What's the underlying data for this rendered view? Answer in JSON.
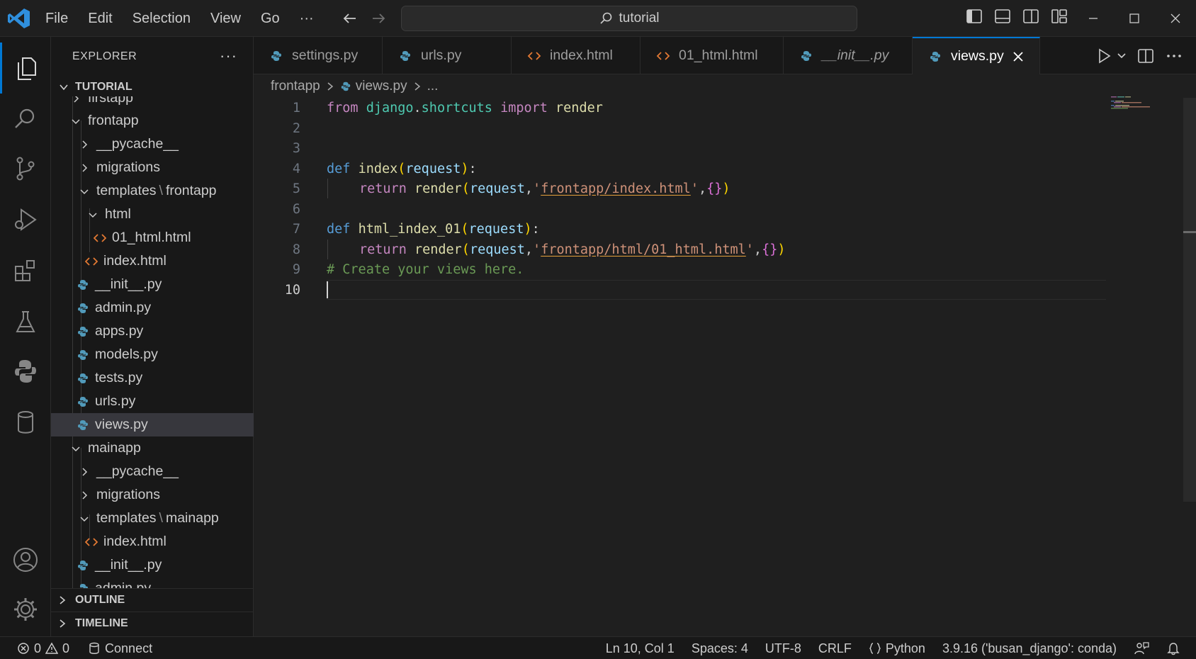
{
  "titlebar": {
    "menu": [
      "File",
      "Edit",
      "Selection",
      "View",
      "Go",
      "···"
    ],
    "search_text": "tutorial"
  },
  "sidebar": {
    "title": "EXPLORER",
    "more": "···",
    "root": "TUTORIAL",
    "partial_top": "firstapp",
    "items": [
      {
        "label": "frontapp",
        "kind": "folder-open"
      },
      {
        "label": "__pycache__",
        "kind": "folder"
      },
      {
        "label": "migrations",
        "kind": "folder"
      },
      {
        "label": "templates",
        "sep": "\\",
        "label2": "frontapp",
        "kind": "folder-open"
      },
      {
        "label": "html",
        "kind": "folder-open"
      },
      {
        "label": "01_html.html",
        "kind": "html"
      },
      {
        "label": "index.html",
        "kind": "html"
      },
      {
        "label": "__init__.py",
        "kind": "py"
      },
      {
        "label": "admin.py",
        "kind": "py"
      },
      {
        "label": "apps.py",
        "kind": "py"
      },
      {
        "label": "models.py",
        "kind": "py"
      },
      {
        "label": "tests.py",
        "kind": "py"
      },
      {
        "label": "urls.py",
        "kind": "py"
      },
      {
        "label": "views.py",
        "kind": "py"
      },
      {
        "label": "mainapp",
        "kind": "folder-open"
      },
      {
        "label": "__pycache__",
        "kind": "folder"
      },
      {
        "label": "migrations",
        "kind": "folder"
      },
      {
        "label": "templates",
        "sep": "\\",
        "label2": "mainapp",
        "kind": "folder-open"
      },
      {
        "label": "index.html",
        "kind": "html"
      },
      {
        "label": "__init__.py",
        "kind": "py"
      }
    ],
    "partial_bottom": "admin.py",
    "outline": "OUTLINE",
    "timeline": "TIMELINE"
  },
  "tabs": [
    {
      "label": "settings.py",
      "kind": "py"
    },
    {
      "label": "urls.py",
      "kind": "py"
    },
    {
      "label": "index.html",
      "kind": "html"
    },
    {
      "label": "01_html.html",
      "kind": "html"
    },
    {
      "label": "__init__.py",
      "kind": "py",
      "italic": true
    },
    {
      "label": "views.py",
      "kind": "py",
      "active": true
    }
  ],
  "breadcrumb": {
    "folder": "frontapp",
    "file": "views.py",
    "more": "..."
  },
  "editor": {
    "line_numbers": [
      "1",
      "2",
      "3",
      "4",
      "5",
      "6",
      "7",
      "8",
      "9",
      "10"
    ],
    "code": {
      "l1_from": "from",
      "l1_mod1": "django",
      "l1_dot": ".",
      "l1_mod2": "shortcuts",
      "l1_import": "import",
      "l1_render": "render",
      "l4_def": "def",
      "l4_name": "index",
      "l4_open": "(",
      "l4_param": "request",
      "l4_close": ")",
      "l4_colon": ":",
      "l5_return": "return",
      "l5_render": "render",
      "l5_open": "(",
      "l5_arg": "request",
      "l5_comma": ",",
      "l5_q1": "'",
      "l5_str": "frontapp/index.html",
      "l5_q2": "'",
      "l5_comma2": ",",
      "l5_dict": "{}",
      "l5_close": ")",
      "l7_def": "def",
      "l7_name": "html_index_01",
      "l7_open": "(",
      "l7_param": "request",
      "l7_close": ")",
      "l7_colon": ":",
      "l8_return": "return",
      "l8_render": "render",
      "l8_open": "(",
      "l8_arg": "request",
      "l8_comma": ",",
      "l8_q1": "'",
      "l8_str": "frontapp/html/01_html.html",
      "l8_q2": "'",
      "l8_comma2": ",",
      "l8_dict": "{}",
      "l8_close": ")",
      "l9_comment": "# Create your views here."
    }
  },
  "status": {
    "errors": "0",
    "warnings": "0",
    "connect": "Connect",
    "position": "Ln 10, Col 1",
    "spaces": "Spaces: 4",
    "encoding": "UTF-8",
    "eol": "CRLF",
    "language": "Python",
    "interpreter": "3.9.16 ('busan_django': conda)"
  },
  "colors": {
    "accent": "#0078d4",
    "folder_chevron": "#cccccc",
    "html_icon": "#e37933",
    "python_icon": "#519aba"
  }
}
